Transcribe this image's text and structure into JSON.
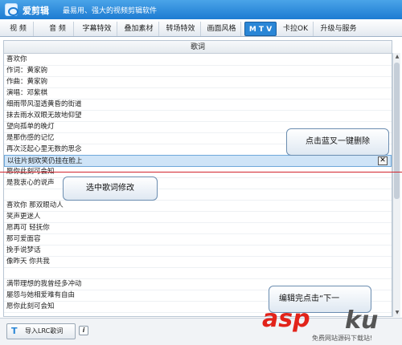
{
  "app": {
    "name": "爱剪辑",
    "slogan": "最易用、强大的视频剪辑软件"
  },
  "tabs": [
    {
      "label": "视  频",
      "active": false
    },
    {
      "label": "音  频",
      "active": false
    },
    {
      "label": "字幕特效",
      "active": false
    },
    {
      "label": "叠加素材",
      "active": false
    },
    {
      "label": "转场特效",
      "active": false
    },
    {
      "label": "画面风格",
      "active": false
    },
    {
      "label": "M T V",
      "active": true
    },
    {
      "label": "卡拉OK",
      "active": false
    },
    {
      "label": "升级与服务",
      "active": false
    }
  ],
  "panel": {
    "header": "歌词",
    "lyrics": [
      "喜欢你",
      "作词：黄家驹",
      "作曲：黄家驹",
      "演唱：邓紫棋",
      "细雨带风湿透黄昏的街道",
      "抹去雨水双眼无故地仰望",
      "望向孤单的晚灯",
      "是那伤感的记忆",
      "再次泛起心里无数的思念",
      "以往片刻欢笑仍挂在脸上",
      "愿你此刻可会知",
      "是我衷心的说声",
      "",
      "喜欢你  那双眼动人",
      "笑声更迷人",
      "愿再可  轻抚你",
      "那可爱面容",
      "挽手说梦话",
      "像昨天  你共我",
      "",
      "满带理想的我曾经多冲动",
      "屡怨与她相爱难有自由",
      "愿你此刻可会知"
    ],
    "selected_index": 9
  },
  "callouts": {
    "delete": "点击蓝叉一键删除",
    "edit": "选中歌词修改",
    "done": "编辑完点击“下一"
  },
  "bottom": {
    "import_label": "导入LRC歌词",
    "info_icon": "i"
  },
  "watermark": {
    "brand": "asp",
    "dot": "ku",
    "sub": "免费网站源码下载站!"
  },
  "colors": {
    "accent": "#2a86d6",
    "titlebar": "#1d7bd2",
    "selected_row": "#cfe4f7",
    "guide_line": "#d2242d",
    "watermark_red": "#e2231a"
  }
}
